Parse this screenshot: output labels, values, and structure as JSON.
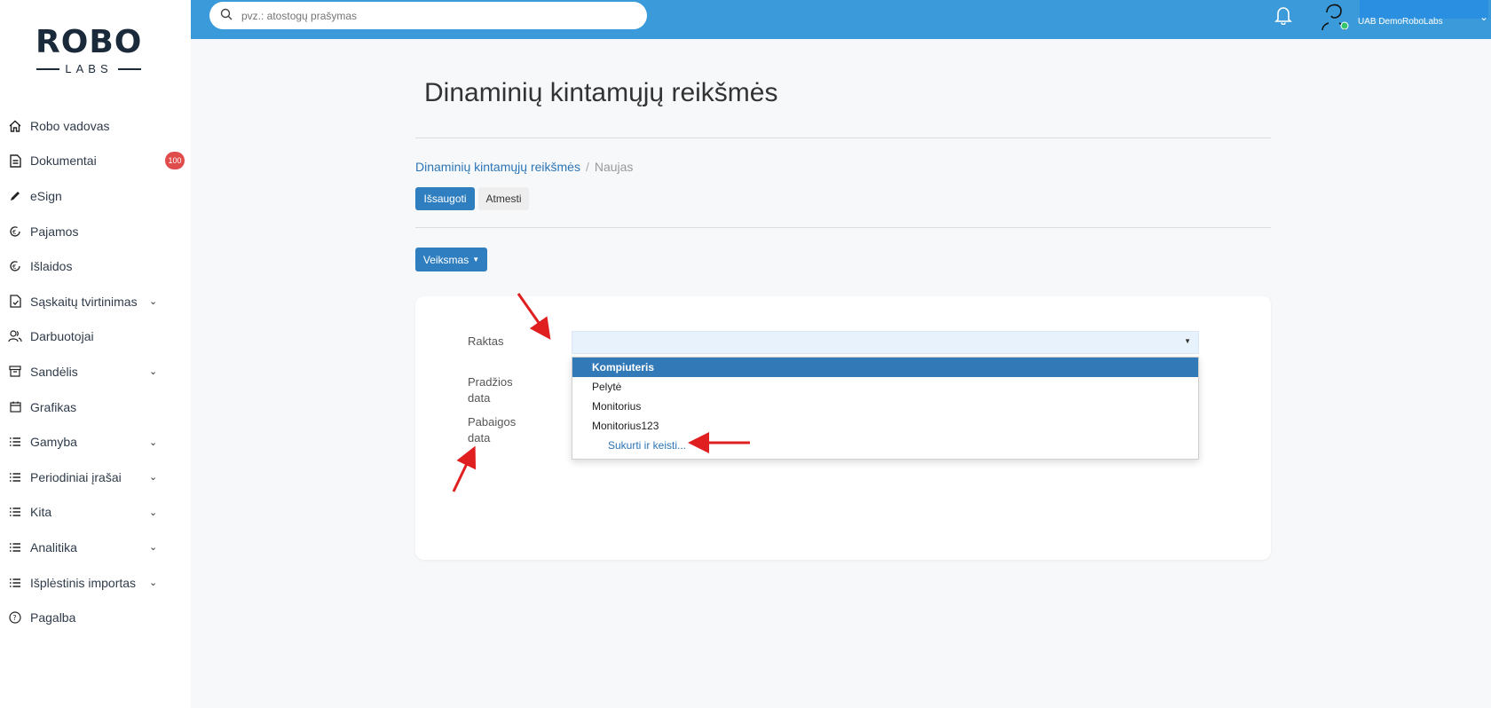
{
  "logo": {
    "main": "ROBO",
    "sub": "LABS"
  },
  "search": {
    "placeholder": "pvz.: atostogų prašymas"
  },
  "user": {
    "company": "UAB DemoRoboLabs"
  },
  "sidebar": {
    "items": [
      {
        "label": "Robo vadovas",
        "icon": "home-icon"
      },
      {
        "label": "Dokumentai",
        "icon": "document-icon",
        "badge": "100"
      },
      {
        "label": "eSign",
        "icon": "pen-icon"
      },
      {
        "label": "Pajamos",
        "icon": "euro-refresh-icon"
      },
      {
        "label": "Išlaidos",
        "icon": "euro-refresh-icon"
      },
      {
        "label": "Sąskaitų tvirtinimas",
        "icon": "file-check-icon",
        "expandable": true
      },
      {
        "label": "Darbuotojai",
        "icon": "users-icon"
      },
      {
        "label": "Sandėlis",
        "icon": "archive-icon",
        "expandable": true
      },
      {
        "label": "Grafikas",
        "icon": "calendar-icon"
      },
      {
        "label": "Gamyba",
        "icon": "list-icon",
        "expandable": true
      },
      {
        "label": "Periodiniai įrašai",
        "icon": "list-icon",
        "expandable": true
      },
      {
        "label": "Kita",
        "icon": "list-icon",
        "expandable": true
      },
      {
        "label": "Analitika",
        "icon": "list-icon",
        "expandable": true
      },
      {
        "label": "Išplėstinis importas",
        "icon": "list-icon",
        "expandable": true
      },
      {
        "label": "Pagalba",
        "icon": "help-icon"
      }
    ]
  },
  "page": {
    "title": "Dinaminių kintamųjų reikšmės",
    "breadcrumb": {
      "parent": "Dinaminių kintamųjų reikšmės",
      "separator": "/",
      "current": "Naujas"
    },
    "save_label": "Išsaugoti",
    "cancel_label": "Atmesti",
    "action_label": "Veiksmas"
  },
  "form": {
    "key_label": "Raktas",
    "start_label": "Pradžios data",
    "end_label": "Pabaigos data"
  },
  "dropdown": {
    "options": [
      "Kompiuteris",
      "Pelytė",
      "Monitorius",
      "Monitorius123"
    ],
    "selected_index": 0,
    "create_label": "Sukurti ir keisti..."
  },
  "colors": {
    "topbar": "#3b9ad9",
    "primary_button": "#2f7fc0",
    "badge": "#e04b4b",
    "annotation_arrow": "#e02020"
  }
}
